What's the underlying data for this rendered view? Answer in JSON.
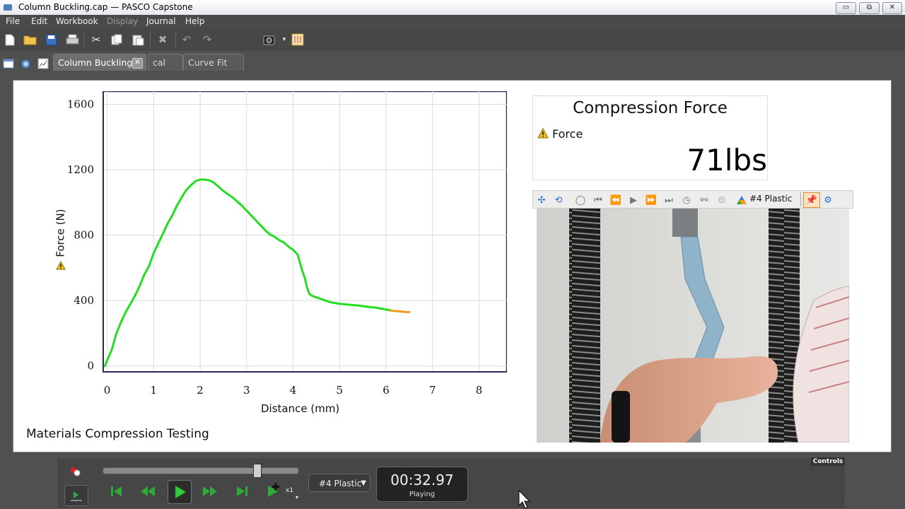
{
  "window": {
    "title": "Column Buckling.cap — PASCO Capstone",
    "min": "▭",
    "max": "⧉",
    "close": "✕"
  },
  "menu": [
    {
      "label": "File"
    },
    {
      "label": "Edit"
    },
    {
      "label": "Workbook"
    },
    {
      "label": "Display",
      "disabled": true
    },
    {
      "label": "Journal"
    },
    {
      "label": "Help"
    }
  ],
  "toolbar": {
    "icons": [
      "new-file-icon",
      "open-folder-icon",
      "save-icon",
      "print-icon",
      "cut-icon",
      "copy-icon",
      "paste-icon",
      "delete-icon",
      "undo-icon",
      "redo-icon",
      "camera-icon",
      "snapshot-icon"
    ]
  },
  "tabs": [
    {
      "label": "Column Buckling",
      "active": true,
      "closable": true
    },
    {
      "label": "cal",
      "active": false
    },
    {
      "label": "Curve Fit",
      "active": false
    }
  ],
  "page": {
    "caption": "Materials Compression Testing"
  },
  "digits": {
    "title": "Compression Force",
    "label": "Force",
    "value": "71lbs"
  },
  "media_toolbar": {
    "run_label": "#4 Plastic"
  },
  "controls": {
    "label": "Controls",
    "run_select": "#4 Plastic",
    "time": "00:32.97",
    "state": "Playing",
    "speed": "x1",
    "slider_fraction": 0.79
  },
  "colors": {
    "green": "#22dd22",
    "orange": "#f39a1c",
    "grid": "#dcdcdc"
  },
  "chart_data": {
    "type": "line",
    "xlabel": "Distance (mm)",
    "ylabel": "Force (N)",
    "xlim": [
      -0.1,
      8.6
    ],
    "ylim": [
      -40,
      1680
    ],
    "xticks": [
      0,
      1,
      2,
      3,
      4,
      5,
      6,
      7,
      8
    ],
    "yticks": [
      0,
      400,
      800,
      1200,
      1600
    ],
    "grid": true,
    "series": [
      {
        "color": "#22dd22",
        "x": [
          -0.05,
          0.1,
          0.2,
          0.3,
          0.4,
          0.5,
          0.6,
          0.7,
          0.8,
          0.9,
          1.0,
          1.1,
          1.2,
          1.3,
          1.4,
          1.5,
          1.6,
          1.7,
          1.8,
          1.9,
          2.0,
          2.1,
          2.2,
          2.3,
          2.4,
          2.5,
          2.6,
          2.7,
          2.8,
          2.9,
          3.0,
          3.1,
          3.2,
          3.3,
          3.4,
          3.5,
          3.6,
          3.7,
          3.8,
          3.9,
          4.0,
          4.1,
          4.15,
          4.2,
          4.25,
          4.3,
          4.35,
          4.4,
          4.5,
          4.6,
          4.7,
          4.8,
          4.9,
          5.0,
          5.2,
          5.4,
          5.6,
          5.8,
          6.0,
          6.1
        ],
        "y": [
          0,
          100,
          200,
          270,
          330,
          380,
          430,
          490,
          560,
          610,
          690,
          750,
          810,
          870,
          920,
          980,
          1030,
          1075,
          1105,
          1130,
          1140,
          1140,
          1135,
          1120,
          1095,
          1070,
          1050,
          1030,
          1005,
          980,
          950,
          920,
          890,
          860,
          830,
          805,
          790,
          770,
          755,
          730,
          710,
          680,
          630,
          580,
          540,
          480,
          440,
          430,
          420,
          410,
          400,
          390,
          385,
          380,
          375,
          370,
          362,
          356,
          345,
          340
        ]
      },
      {
        "color": "#f39a1c",
        "x": [
          6.1,
          6.2,
          6.3,
          6.4,
          6.5
        ],
        "y": [
          340,
          336,
          334,
          331,
          330
        ]
      }
    ]
  }
}
